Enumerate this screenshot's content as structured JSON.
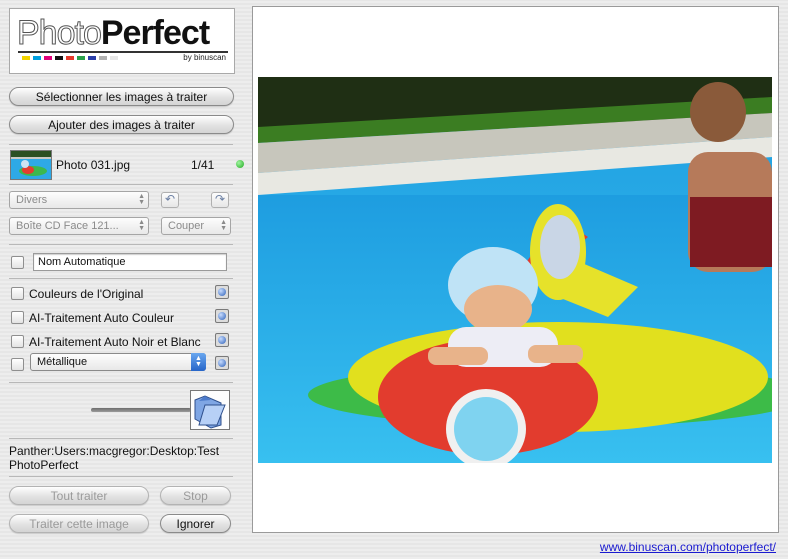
{
  "logo": {
    "photo": "Photo",
    "perfect": "Perfect",
    "byline": "by binuscan",
    "color_dots": [
      "#f2d400",
      "#00a0e0",
      "#e0007a",
      "#111111",
      "#e63a2c",
      "#2aa04a",
      "#2a3ea8",
      "#b0b0b0",
      "#e6e6e6"
    ]
  },
  "buttons": {
    "select_images": "Sélectionner les images à traiter",
    "add_images": "Ajouter des images à traiter",
    "process_all": "Tout traiter",
    "stop": "Stop",
    "process_this": "Traiter cette image",
    "ignore": "Ignorer"
  },
  "file": {
    "name": "Photo 031.jpg",
    "counter": "1/41",
    "status_color": "#22aa22"
  },
  "controls": {
    "category_select": "Divers",
    "format_select": "Boîte CD Face 121...",
    "crop_select": "Couper",
    "undo_icon": "undo-arrow-icon",
    "redo_icon": "redo-arrow-icon"
  },
  "naming": {
    "checkbox_label": "",
    "field_value": "Nom Automatique"
  },
  "options": [
    {
      "label": "Couleurs de l'Original",
      "checked": false
    },
    {
      "label": "AI-Traitement Auto Couleur",
      "checked": false
    },
    {
      "label": "AI-Traitement Auto Noir et Blanc",
      "checked": false
    }
  ],
  "effect_select": "Métallique",
  "output_path": "Panther:Users:macgregor:Desktop:Test PhotoPerfect",
  "footer": {
    "link": "www.binuscan.com/photoperfect/"
  }
}
